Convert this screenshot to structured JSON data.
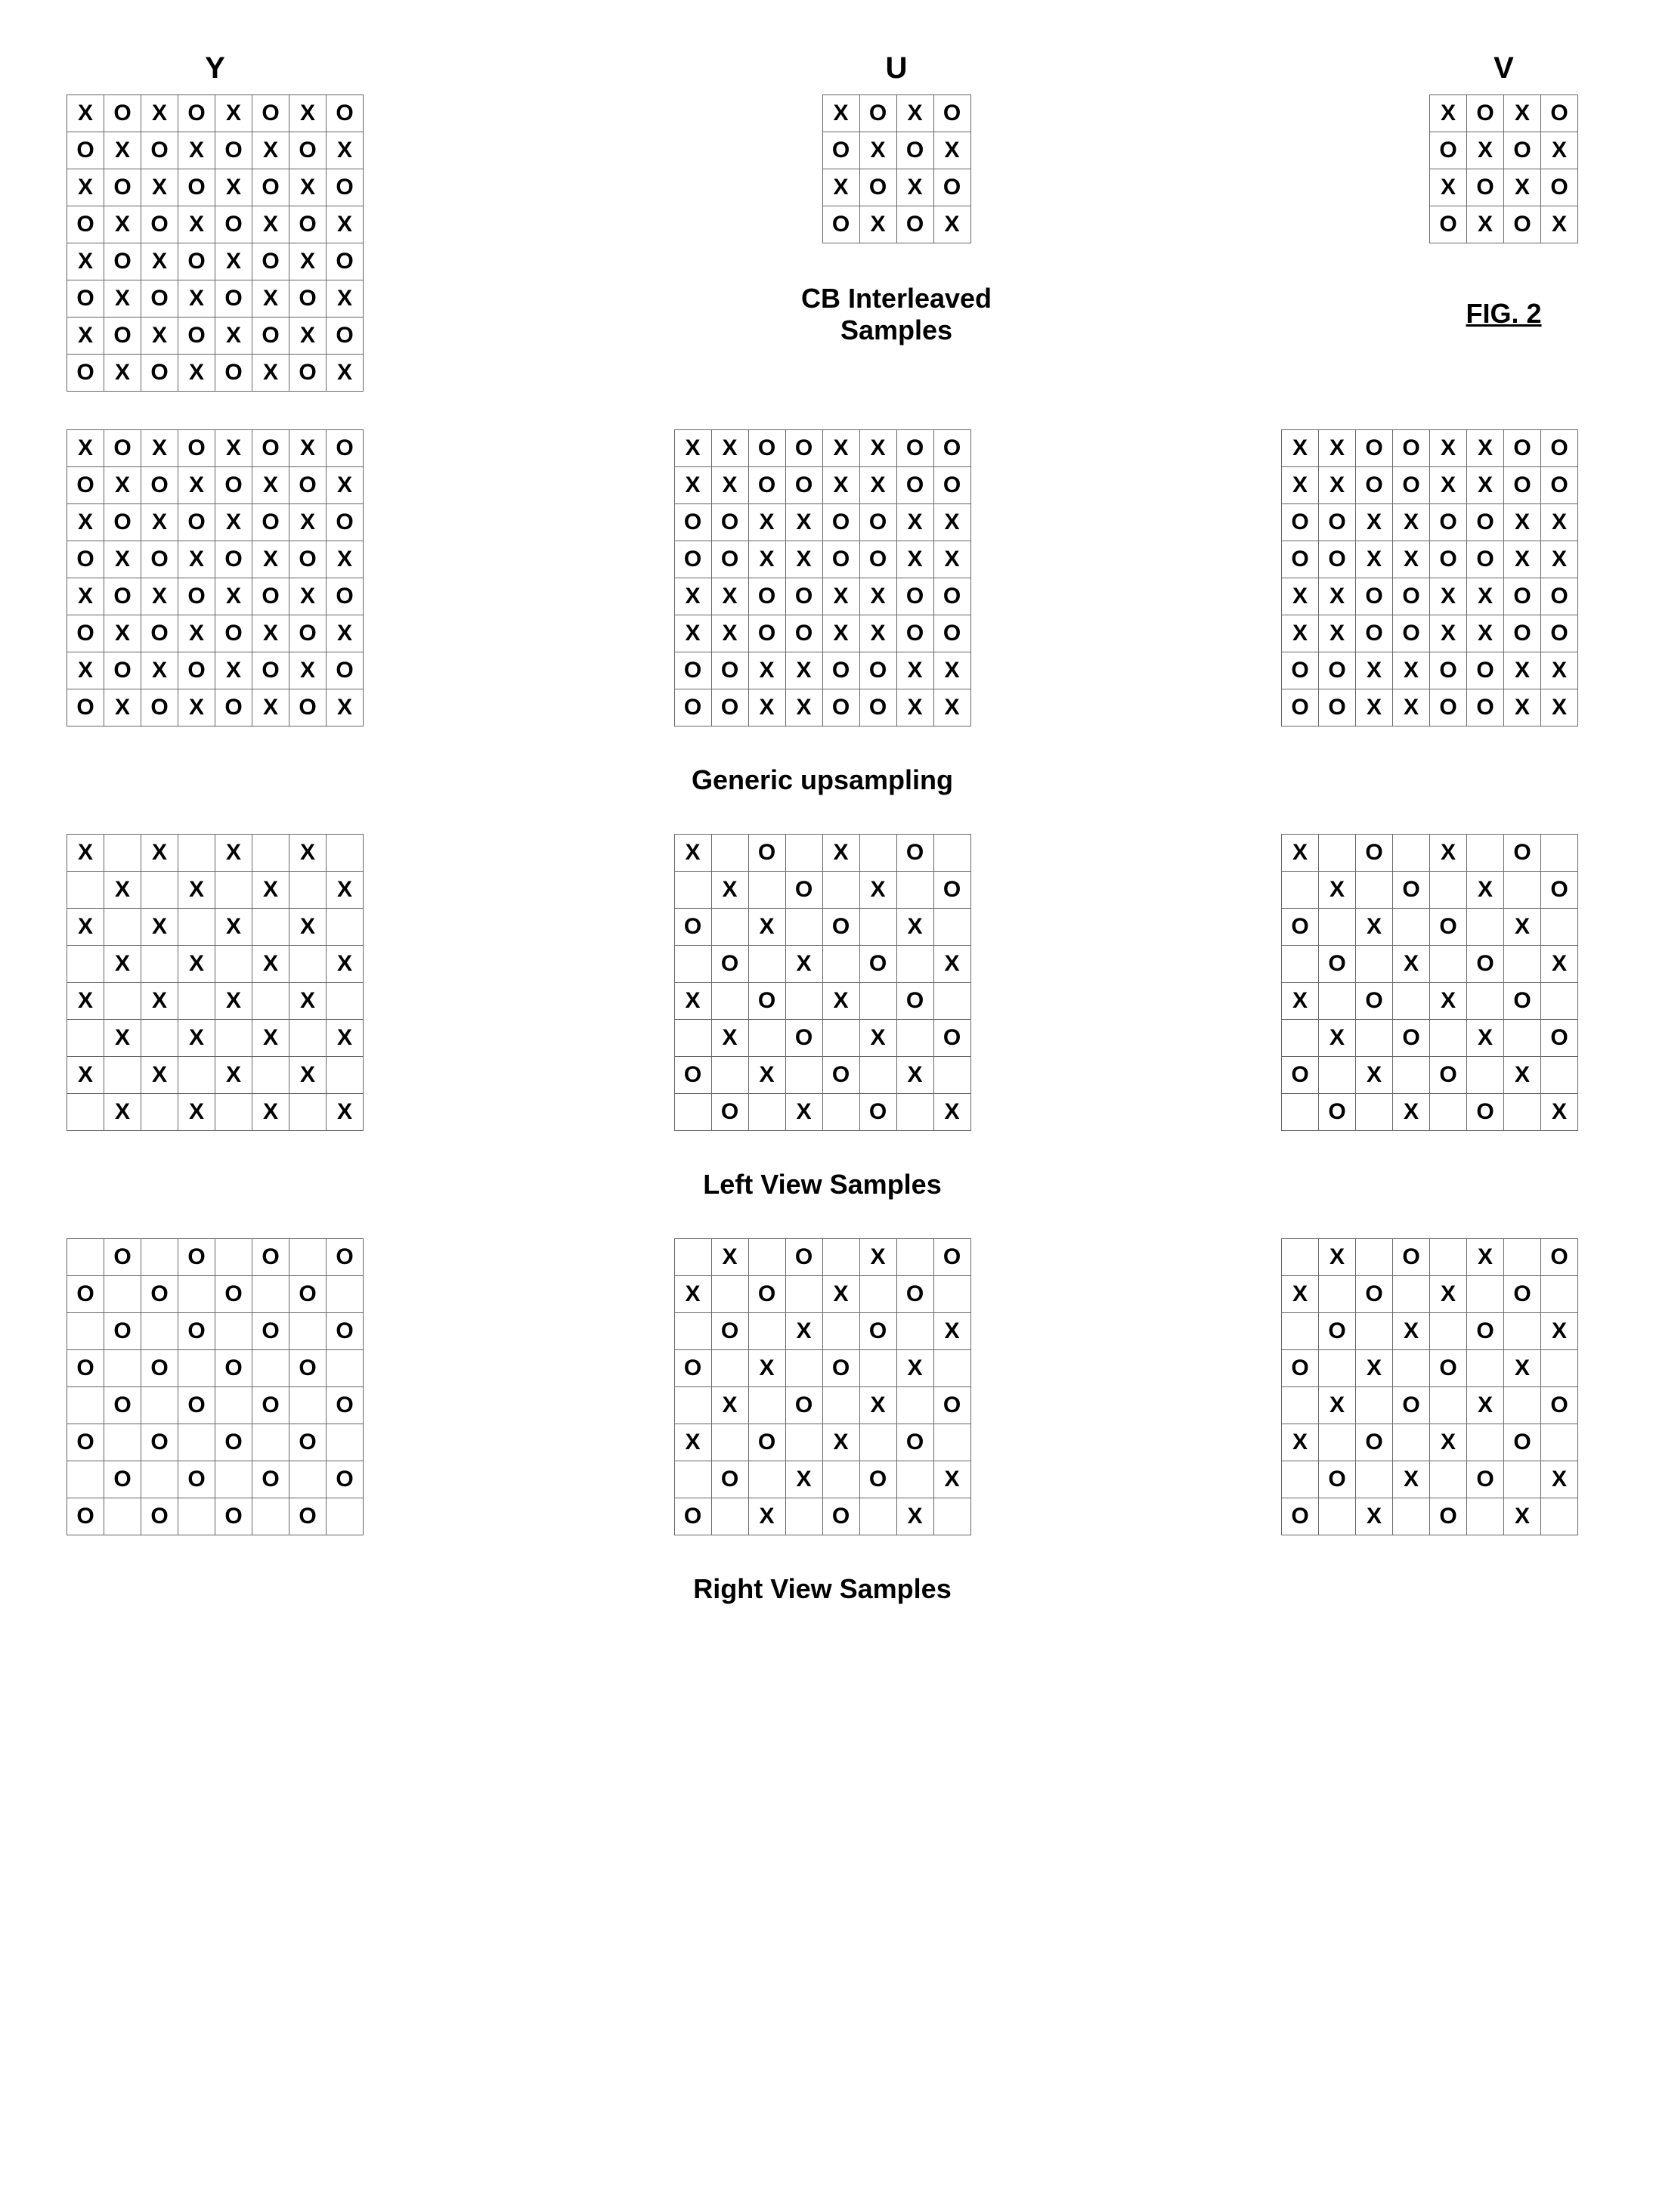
{
  "headers": {
    "y": "Y",
    "u": "U",
    "v": "V"
  },
  "labels": {
    "cb_interleaved": "CB Interleaved\nSamples",
    "fig": "FIG. 2",
    "generic_upsampling": "Generic upsampling",
    "left_view": "Left View Samples",
    "right_view": "Right View Samples"
  },
  "symbols": {
    "x": "X",
    "o": "O",
    "blank": ""
  },
  "grids": {
    "top_Y": {
      "rows": 8,
      "cols": 8,
      "pattern": "checker_xo"
    },
    "top_U": {
      "rows": 4,
      "cols": 4,
      "pattern": "checker_xo"
    },
    "top_V": {
      "rows": 4,
      "cols": 4,
      "pattern": "checker_xo"
    },
    "row2_Y": {
      "rows": 8,
      "cols": 8,
      "pattern": "checker_xo"
    },
    "row2_U": {
      "rows": 8,
      "cols": 8,
      "pattern": "block2_xo"
    },
    "row2_V": {
      "rows": 8,
      "cols": 8,
      "pattern": "block2_xo"
    },
    "row3_Y": {
      "rows": 8,
      "cols": 8,
      "pattern": "checker_x_blank"
    },
    "row3_U": {
      "rows": 8,
      "cols": 8,
      "pattern": "checker_xo_blank_even"
    },
    "row3_V": {
      "rows": 8,
      "cols": 8,
      "pattern": "checker_xo_blank_even"
    },
    "row4_Y": {
      "rows": 8,
      "cols": 8,
      "pattern": "checker_blank_o"
    },
    "row4_U": {
      "rows": 8,
      "cols": 8,
      "pattern": "checker_xo_blank_odd"
    },
    "row4_V": {
      "rows": 8,
      "cols": 8,
      "pattern": "checker_xo_blank_odd"
    }
  }
}
